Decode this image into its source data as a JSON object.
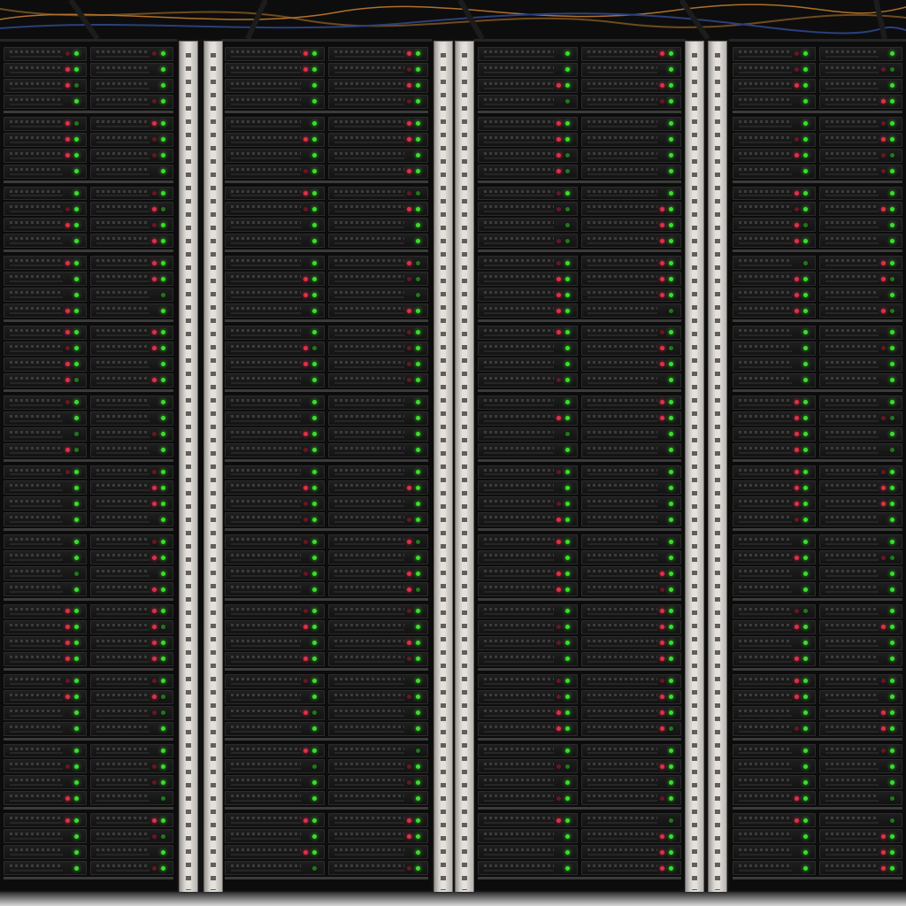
{
  "scene": {
    "subject": "",
    "racks": 4,
    "units_per_rack": 12,
    "bays_per_unit": 2,
    "trays_per_bay": 4
  },
  "colors": {
    "led_green": "#39e02a",
    "led_green_dim": "#1f7a18",
    "led_red": "#e0304a",
    "led_red_dim": "#6a1622",
    "rail_steel": "#d6d3cf",
    "chassis": "#161616",
    "cable_orange": "#b0702a",
    "cable_blue": "#2b3f7a"
  },
  "icons": [
    "server-chassis-icon",
    "status-led-icon",
    "rack-rail-icon"
  ]
}
